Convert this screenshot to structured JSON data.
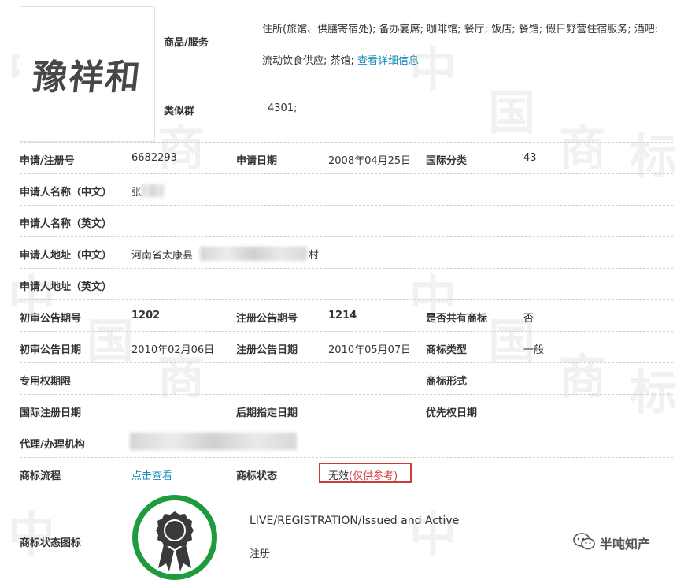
{
  "trademark": {
    "name_text": "豫祥和"
  },
  "goods": {
    "label": "商品/服务",
    "text": "住所(旅馆、供膳寄宿处); 备办宴席; 咖啡馆; 餐厅; 饭店; 餐馆; 假日野营住宿服务; 酒吧; 流动饮食供应; 茶馆; ",
    "link": "查看详细信息"
  },
  "similar_group": {
    "label": "类似群",
    "value": "4301;"
  },
  "fields": {
    "reg_no": {
      "label": "申请/注册号",
      "value": "6682293"
    },
    "app_date": {
      "label": "申请日期",
      "value": "2008年04月25日"
    },
    "intl_class": {
      "label": "国际分类",
      "value": "43"
    },
    "applicant_cn": {
      "label": "申请人名称（中文）",
      "value": "张"
    },
    "applicant_en": {
      "label": "申请人名称（英文）",
      "value": ""
    },
    "address_cn": {
      "label": "申请人地址（中文）",
      "value": "河南省太康县",
      "value_suffix": "村"
    },
    "address_en": {
      "label": "申请人地址（英文）",
      "value": ""
    },
    "prelim_issue": {
      "label": "初审公告期号",
      "value": "1202"
    },
    "reg_issue": {
      "label": "注册公告期号",
      "value": "1214"
    },
    "shared": {
      "label": "是否共有商标",
      "value": "否"
    },
    "prelim_date": {
      "label": "初审公告日期",
      "value": "2010年02月06日"
    },
    "reg_date": {
      "label": "注册公告日期",
      "value": "2010年05月07日"
    },
    "tm_type": {
      "label": "商标类型",
      "value": "一般"
    },
    "exclusive_term": {
      "label": "专用权期限",
      "value": ""
    },
    "tm_form": {
      "label": "商标形式",
      "value": ""
    },
    "intl_reg_date": {
      "label": "国际注册日期",
      "value": ""
    },
    "later_date": {
      "label": "后期指定日期",
      "value": ""
    },
    "priority_date": {
      "label": "优先权日期",
      "value": ""
    },
    "agent": {
      "label": "代理/办理机构",
      "value": ""
    },
    "process": {
      "label": "商标流程",
      "link": "点击查看"
    },
    "status": {
      "label": "商标状态",
      "value": "无效",
      "note": "(仅供参考)"
    },
    "status_icon": {
      "label": "商标状态图标",
      "status_en": "LIVE/REGISTRATION/Issued and Active",
      "status_cn": "注册"
    }
  },
  "watermark": {
    "chars": [
      "中",
      "国",
      "商",
      "标"
    ]
  },
  "footer": {
    "account": "半吨知产"
  },
  "colors": {
    "link": "#1a8ab5",
    "status_red": "#d23a3a",
    "badge_green": "#1f9a3c"
  }
}
